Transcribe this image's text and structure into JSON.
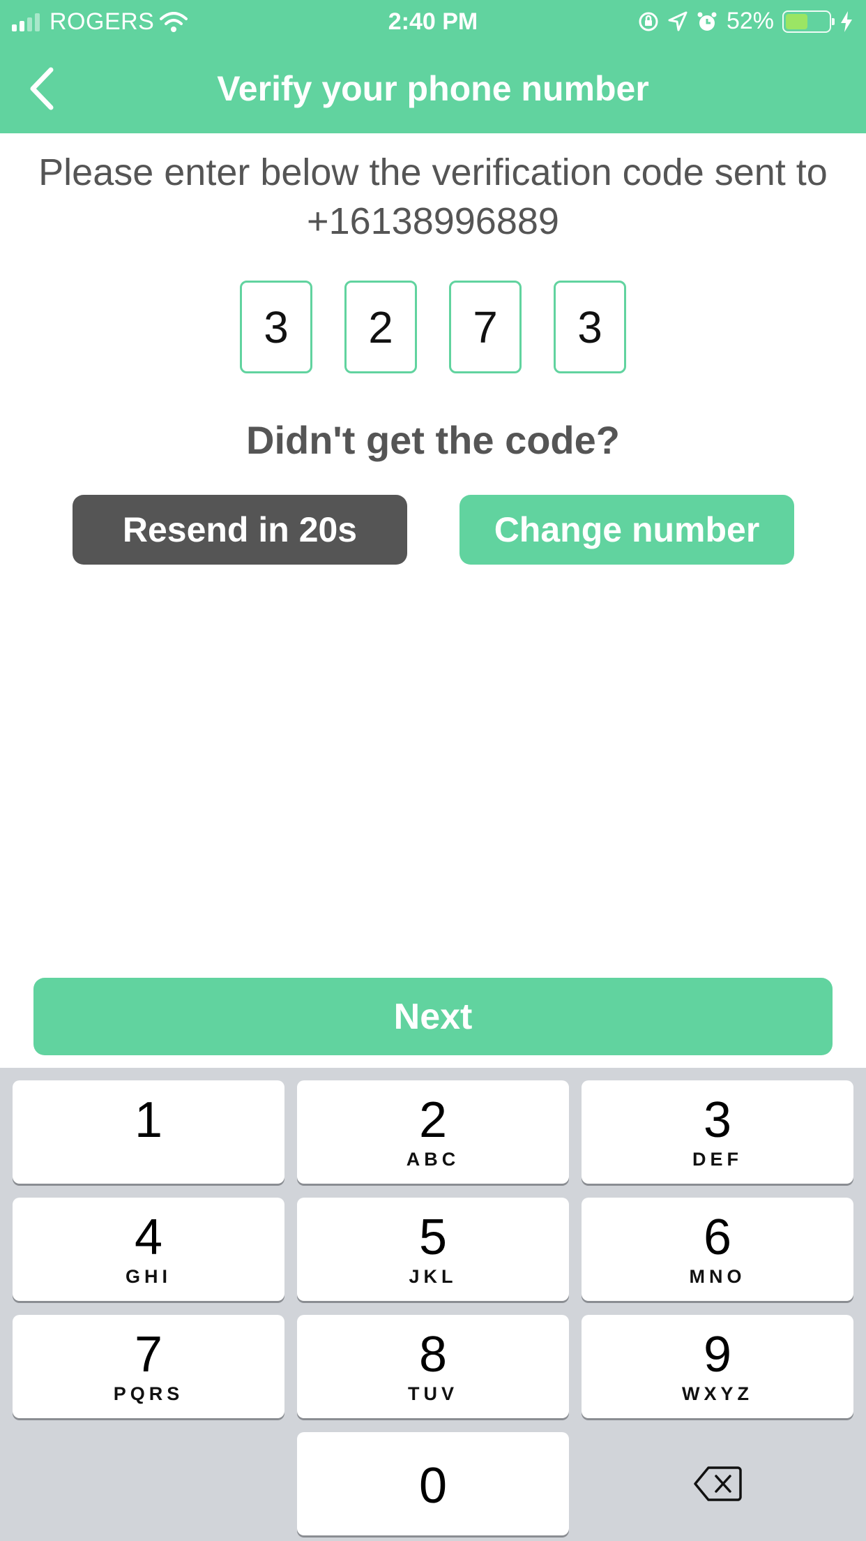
{
  "status_bar": {
    "carrier": "ROGERS",
    "time": "2:40 PM",
    "battery_percent": "52%",
    "battery_level": 0.52,
    "icons": [
      "signal-icon",
      "wifi-icon",
      "orientation-lock-icon",
      "location-icon",
      "alarm-icon",
      "battery-icon",
      "charging-icon"
    ]
  },
  "header": {
    "title": "Verify your phone number",
    "back_icon": "chevron-left-icon"
  },
  "instructions": {
    "text": "Please enter below the verification code sent to +16138996889"
  },
  "code": {
    "digits": [
      "3",
      "2",
      "7",
      "3"
    ]
  },
  "resend_section": {
    "prompt": "Didn't get the code?",
    "resend_label": "Resend in 20s",
    "change_label": "Change number"
  },
  "next_label": "Next",
  "keypad": {
    "keys": [
      {
        "num": "1",
        "letters": ""
      },
      {
        "num": "2",
        "letters": "ABC"
      },
      {
        "num": "3",
        "letters": "DEF"
      },
      {
        "num": "4",
        "letters": "GHI"
      },
      {
        "num": "5",
        "letters": "JKL"
      },
      {
        "num": "6",
        "letters": "MNO"
      },
      {
        "num": "7",
        "letters": "PQRS"
      },
      {
        "num": "8",
        "letters": "TUV"
      },
      {
        "num": "9",
        "letters": "WXYZ"
      },
      {
        "num": "0",
        "letters": ""
      }
    ],
    "backspace_icon": "backspace-icon"
  },
  "colors": {
    "accent": "#61d39f",
    "dark_button": "#555555",
    "text": "#555555",
    "keyboard_bg": "#d1d4d9"
  }
}
